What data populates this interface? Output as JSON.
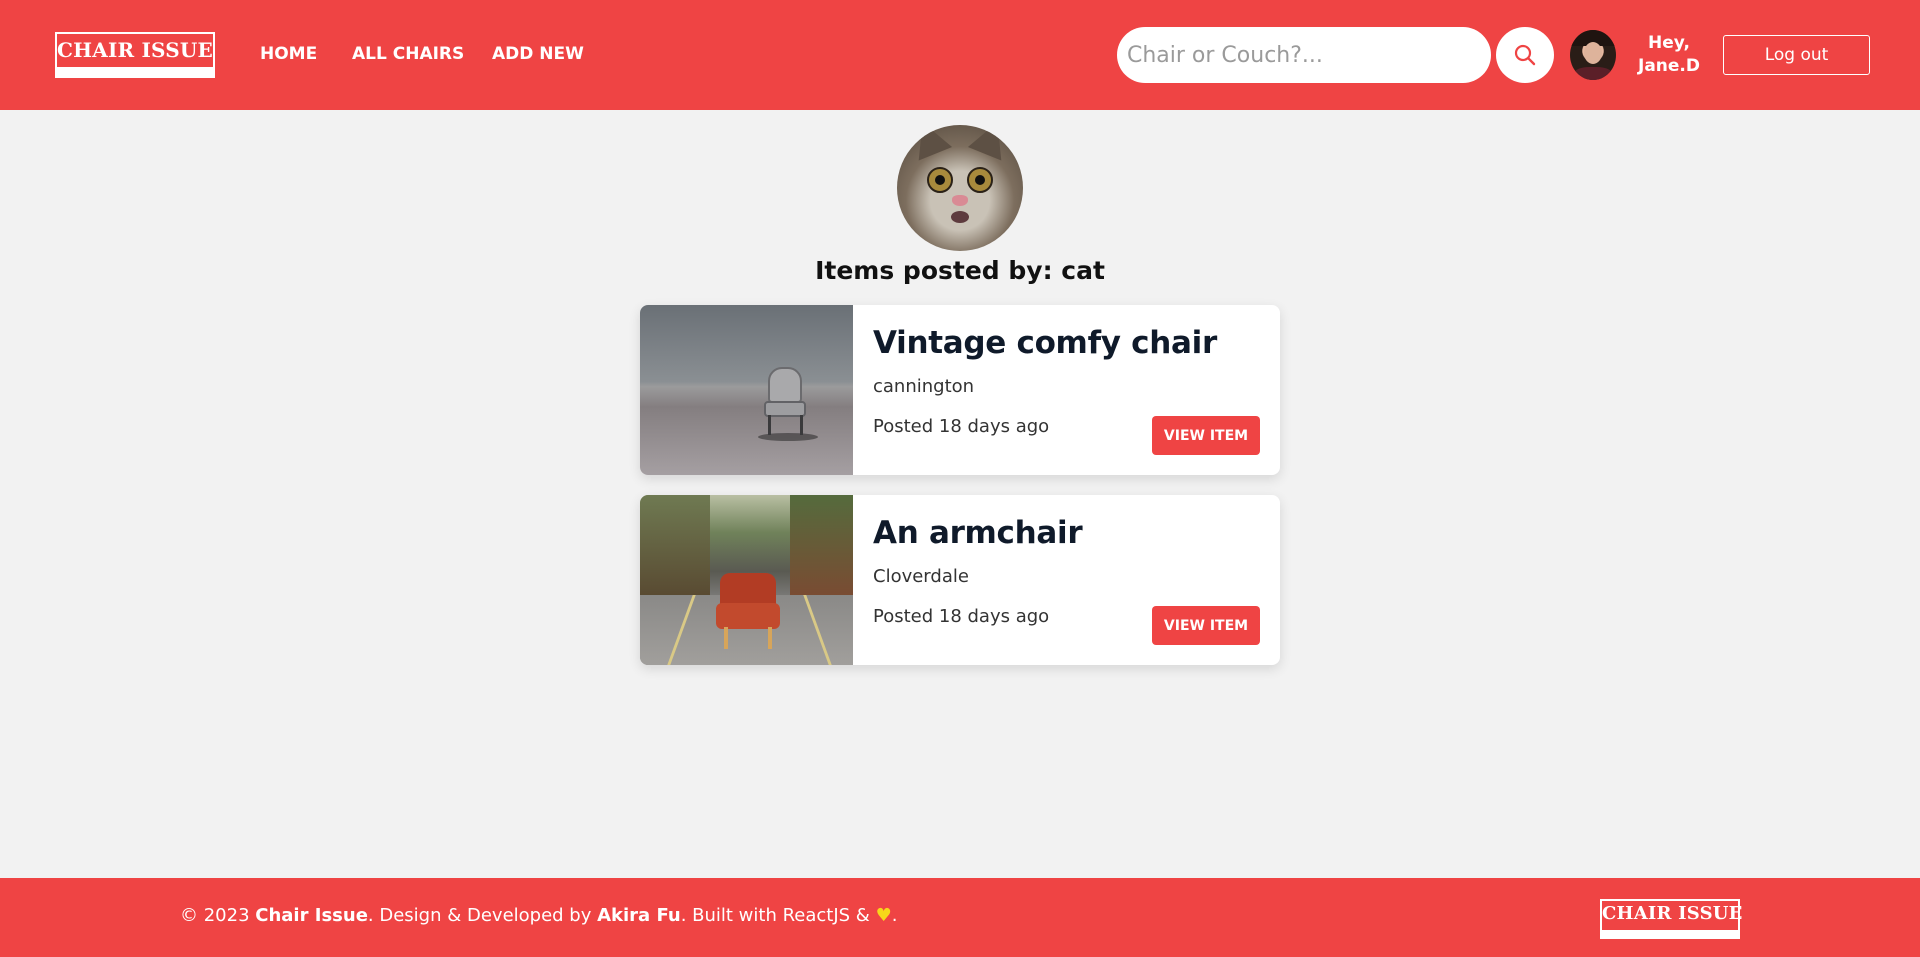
{
  "header": {
    "logo": "CHAIR ISSUE",
    "nav": {
      "home": "HOME",
      "all_chairs": "ALL CHAIRS",
      "add_new": "ADD NEW"
    },
    "search": {
      "placeholder": "Chair or Couch?...",
      "value": ""
    },
    "greeting_line1": "Hey,",
    "greeting_line2": "Jane.D",
    "logout": "Log out"
  },
  "profile": {
    "title": "Items posted by: cat"
  },
  "items": [
    {
      "title": "Vintage comfy chair",
      "location": "cannington",
      "posted": "Posted 18 days ago",
      "button": "VIEW ITEM"
    },
    {
      "title": "An armchair",
      "location": "Cloverdale",
      "posted": "Posted 18 days ago",
      "button": "VIEW ITEM"
    }
  ],
  "footer": {
    "copyright": "© 2023 ",
    "brand": "Chair Issue",
    "mid": ". Design & Developed by ",
    "author": "Akira Fu",
    "built": ". Built with ReactJS & ",
    "end": ".",
    "logo": "CHAIR ISSUE"
  },
  "colors": {
    "brand": "#ef4444",
    "background": "#f2f2f2",
    "heart": "#f7d71a"
  },
  "icons": [
    "search-icon",
    "heart-icon"
  ]
}
